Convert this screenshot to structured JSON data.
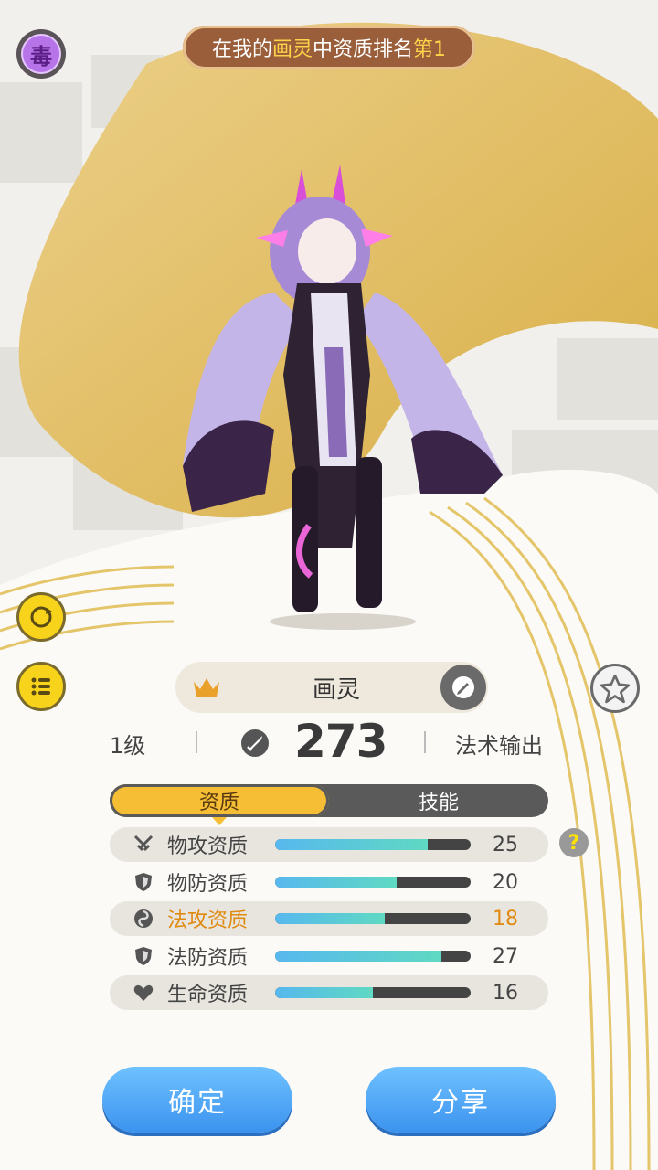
{
  "header": {
    "poison_badge": "毒",
    "rank_prefix": "在我的",
    "rank_pet": "画灵",
    "rank_mid": "中资质排名",
    "rank_place": "第1"
  },
  "pet": {
    "name": "画灵",
    "level": "1级",
    "power": "273",
    "role": "法术输出"
  },
  "tabs": [
    "资质",
    "技能"
  ],
  "attributes": [
    {
      "label": "物攻资质",
      "value": "25",
      "fill": 0.78,
      "icon": "swords-icon"
    },
    {
      "label": "物防资质",
      "value": "20",
      "fill": 0.62,
      "icon": "shield-icon"
    },
    {
      "label": "法攻资质",
      "value": "18",
      "fill": 0.56,
      "icon": "magic-swirl-icon"
    },
    {
      "label": "法防资质",
      "value": "27",
      "fill": 0.85,
      "icon": "shield-icon"
    },
    {
      "label": "生命资质",
      "value": "16",
      "fill": 0.5,
      "icon": "heart-icon"
    }
  ],
  "help": "?",
  "buttons": {
    "confirm": "确定",
    "share": "分享"
  },
  "colors": {
    "accent_gold": "#f5be35",
    "highlight_orange": "#e08a10",
    "button_blue": "#3b93ee"
  }
}
